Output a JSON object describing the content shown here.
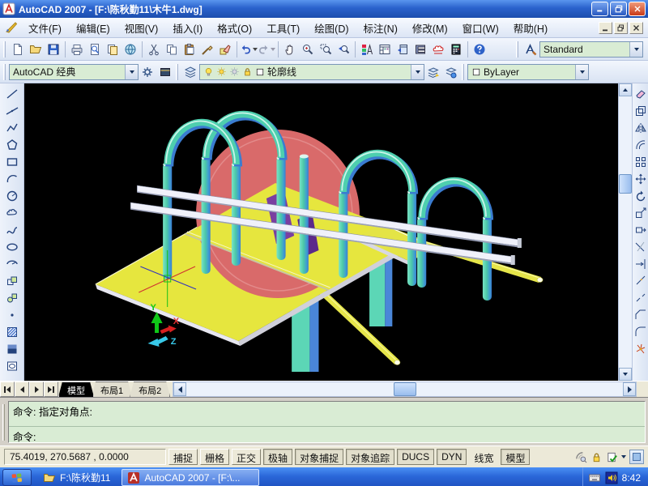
{
  "palette": {
    "titlebar_top": "#5a96ee",
    "titlebar_bottom": "#1c4eae",
    "toolbar_bg": "#e7eefb",
    "field_green": "#d9ecd4",
    "canvas_bg": "#000000",
    "model_yellow": "#e6e63e",
    "model_red": "#d96a6a",
    "model_teal": "#4ecfae",
    "model_blue": "#3a7cd0",
    "model_purple": "#7a3fa0",
    "model_rail_white": "#f0f1fa",
    "ucs_x": "#e03030",
    "ucs_y": "#10c818",
    "ucs_z": "#38c8e8",
    "status_bg": "#ece9d8",
    "taskbar_blue": "#2a66d8"
  },
  "titlebar": {
    "title": "AutoCAD 2007 - [F:\\陈秋勤11\\木牛1.dwg]",
    "buttons": [
      "minimize",
      "restore",
      "close"
    ]
  },
  "menubar": {
    "items": [
      "文件(F)",
      "编辑(E)",
      "视图(V)",
      "插入(I)",
      "格式(O)",
      "工具(T)",
      "绘图(D)",
      "标注(N)",
      "修改(M)",
      "窗口(W)",
      "帮助(H)"
    ]
  },
  "toolbar_standard": {
    "icons": [
      "new",
      "open",
      "save",
      "plot",
      "plot-preview",
      "publish",
      "etransmit",
      "cut",
      "copy",
      "paste",
      "match-properties",
      "block-editor",
      "undo",
      "redo",
      "pan",
      "zoom-realtime",
      "zoom-window",
      "zoom-previous",
      "properties",
      "designcenter",
      "tool-palettes",
      "sheet-set-manager",
      "markup-set-manager",
      "quickcalc",
      "help"
    ]
  },
  "toolbar_styles": {
    "text_style_value": "Standard"
  },
  "toolbar_workspaces": {
    "value": "AutoCAD 经典",
    "icons": [
      "workspace-settings-gear",
      "my-workspace"
    ]
  },
  "toolbar_layers": {
    "layer_value": "轮廓线",
    "layer_state_icons": [
      "bulb-on",
      "sun-on",
      "sun-freeze",
      "lock-unlocked",
      "color-swatch"
    ],
    "tool_icons": [
      "layer-properties",
      "layer-previous",
      "layer-states"
    ],
    "color_value": "ByLayer"
  },
  "draw_toolbar": {
    "icons": [
      "line",
      "construction-line",
      "polyline",
      "polygon",
      "rectangle",
      "arc",
      "circle",
      "revision-cloud",
      "spline",
      "ellipse",
      "ellipse-arc",
      "insert-block",
      "make-block",
      "point",
      "hatch",
      "gradient",
      "region"
    ]
  },
  "modify_toolbar": {
    "icons": [
      "erase",
      "copy",
      "mirror",
      "offset",
      "array",
      "move",
      "rotate",
      "scale",
      "stretch",
      "trim",
      "extend",
      "break-at-point",
      "break",
      "chamfer",
      "fillet",
      "explode"
    ]
  },
  "canvas": {
    "ucs_labels": {
      "x": "X",
      "y": "Y",
      "z": "Z"
    }
  },
  "tabs": {
    "items": [
      "模型",
      "布局1",
      "布局2"
    ],
    "active_index": 0
  },
  "command": {
    "history_line": "命令: 指定对角点:",
    "input_line": "命令:"
  },
  "statusbar": {
    "coordinates": "75.4019,  270.5687 ,  0.0000",
    "toggles": [
      {
        "label": "捕捉",
        "state": "raised"
      },
      {
        "label": "栅格",
        "state": "raised"
      },
      {
        "label": "正交",
        "state": "raised"
      },
      {
        "label": "极轴",
        "state": "pressed"
      },
      {
        "label": "对象捕捉",
        "state": "pressed"
      },
      {
        "label": "对象追踪",
        "state": "pressed"
      },
      {
        "label": "DUCS",
        "state": "pressed"
      },
      {
        "label": "DYN",
        "state": "pressed"
      },
      {
        "label": "线宽",
        "state": "flat"
      },
      {
        "label": "模型",
        "state": "pressed"
      }
    ],
    "tray_icons": [
      "communication-center",
      "toolbar-lock",
      "validate-check",
      "status-menu-arrow",
      "clean-screen"
    ]
  },
  "taskbar": {
    "items": [
      {
        "label": "F:\\陈秋勤11",
        "icon": "folder",
        "active": false
      },
      {
        "label": "AutoCAD 2007 - [F:\\...",
        "icon": "autocad",
        "active": true
      }
    ],
    "tray": {
      "icons": [
        "keyboard",
        "volume"
      ],
      "clock": "8:42"
    }
  }
}
